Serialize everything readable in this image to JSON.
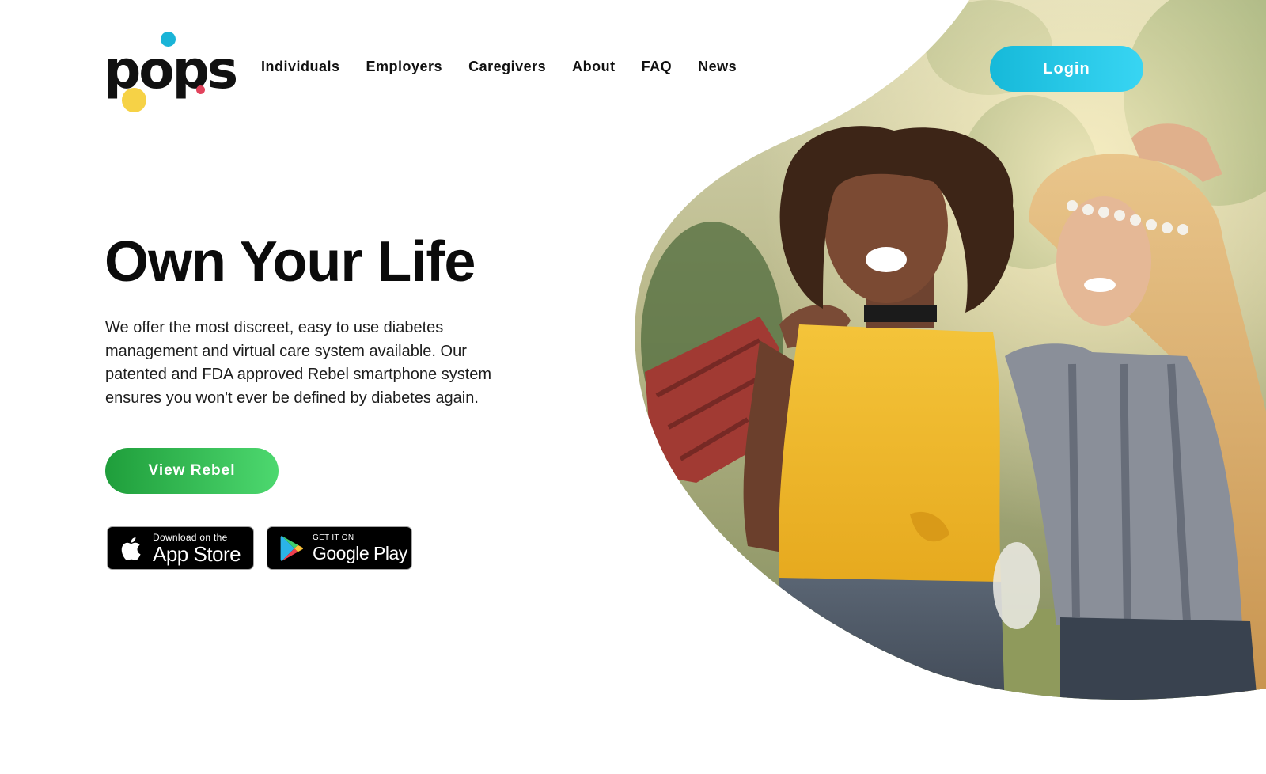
{
  "brand": {
    "logo_text": "pops",
    "colors": {
      "blue": "#1ab4d7",
      "yellow": "#f6d246",
      "pink": "#e2435c"
    }
  },
  "nav": {
    "items": [
      {
        "label": "Individuals"
      },
      {
        "label": "Employers"
      },
      {
        "label": "Caregivers"
      },
      {
        "label": "About"
      },
      {
        "label": "FAQ"
      },
      {
        "label": "News"
      }
    ]
  },
  "header": {
    "login_label": "Login"
  },
  "hero": {
    "title": "Own Your Life",
    "description": "We offer the most discreet, easy to use diabetes management and virtual care system available. Our patented and FDA approved Rebel smartphone system ensures you won't ever be defined by diabetes again.",
    "cta_label": "View Rebel",
    "image_alt": "Two smiling young women at an outdoor festival"
  },
  "store_badges": {
    "apple": {
      "small": "Download on the",
      "big": "App Store",
      "icon": "apple-icon"
    },
    "google": {
      "small": "GET IT ON",
      "big": "Google Play",
      "icon": "google-play-icon"
    }
  },
  "colors": {
    "login_gradient": [
      "#16b9d9",
      "#38d5f3"
    ],
    "cta_gradient": [
      "#1f9e3b",
      "#4dd86f"
    ]
  }
}
